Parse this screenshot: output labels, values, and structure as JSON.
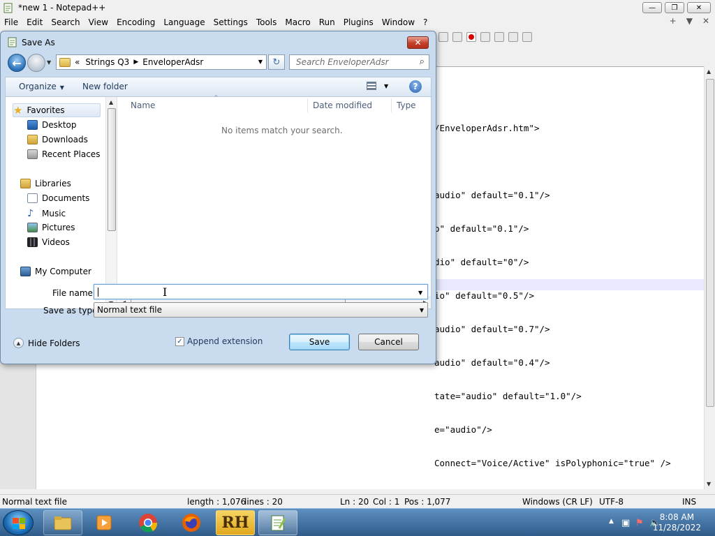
{
  "npp": {
    "title": "*new 1 - Notepad++",
    "menu": [
      "File",
      "Edit",
      "Search",
      "View",
      "Encoding",
      "Language",
      "Settings",
      "Tools",
      "Macro",
      "Run",
      "Plugins",
      "Window",
      "?"
    ],
    "menu_right": [
      "+",
      "▼",
      "✕"
    ],
    "win_min": "—",
    "win_max": "❐",
    "win_close": "✕",
    "code_lines": [
      "/EnveloperAdsr.htm\">",
      "",
      "audio\" default=\"0.1\"/>",
      "o\" default=\"0.1\"/>",
      "dio\" default=\"0\"/>",
      "io\" default=\"0.5\"/>",
      "audio\" default=\"0.7\"/>",
      "audio\" default=\"0.4\"/>",
      "tate=\"audio\" default=\"1.0\"/>",
      "e=\"audio\"/>",
      "Connect=\"Voice/Active\" isPolyphonic=\"true\" />"
    ],
    "status": {
      "type": "Normal text file",
      "length": "length : 1,076",
      "lines": "lines : 20",
      "ln": "Ln : 20",
      "col": "Col : 1",
      "pos": "Pos : 1,077",
      "eol": "Windows (CR LF)",
      "encoding": "UTF-8",
      "mode": "INS"
    }
  },
  "dialog": {
    "title": "Save As",
    "close_label": "✕",
    "back_label": "←",
    "address": {
      "lead": "«",
      "crumbs": [
        "Strings Q3",
        "EnveloperAdsr"
      ],
      "sep": "▶"
    },
    "refresh_label": "↻",
    "search_placeholder": "Search EnveloperAdsr",
    "search_icon": "⌕",
    "commands": {
      "organize": "Organize",
      "new_folder": "New folder",
      "help": "?"
    },
    "nav": {
      "favorites": "Favorites",
      "desktop": "Desktop",
      "downloads": "Downloads",
      "recent": "Recent Places",
      "libraries": "Libraries",
      "documents": "Documents",
      "music": "Music",
      "pictures": "Pictures",
      "videos": "Videos",
      "computer": "My Computer"
    },
    "columns": [
      "Name",
      "Date modified",
      "Type"
    ],
    "empty_message": "No items match your search.",
    "file_name_label": "File name:",
    "file_name_value": "",
    "save_type_label": "Save as type:",
    "save_type_value": "Normal text file",
    "hide_folders": "Hide Folders",
    "append_extension": "Append extension",
    "append_checked": "✓",
    "save": "Save",
    "cancel": "Cancel"
  },
  "taskbar": {
    "time": "8:08 AM",
    "date": "11/28/2022",
    "apps": [
      "explorer",
      "media-player",
      "chrome",
      "firefox",
      "rh-app",
      "notepad-plus-plus"
    ],
    "rh_label": "RH"
  },
  "colors": {
    "accent": "#3c7fb1",
    "dialog_frame": "#c9dbee",
    "close_red": "#c4402a",
    "taskbar": "#2f5b8a"
  }
}
